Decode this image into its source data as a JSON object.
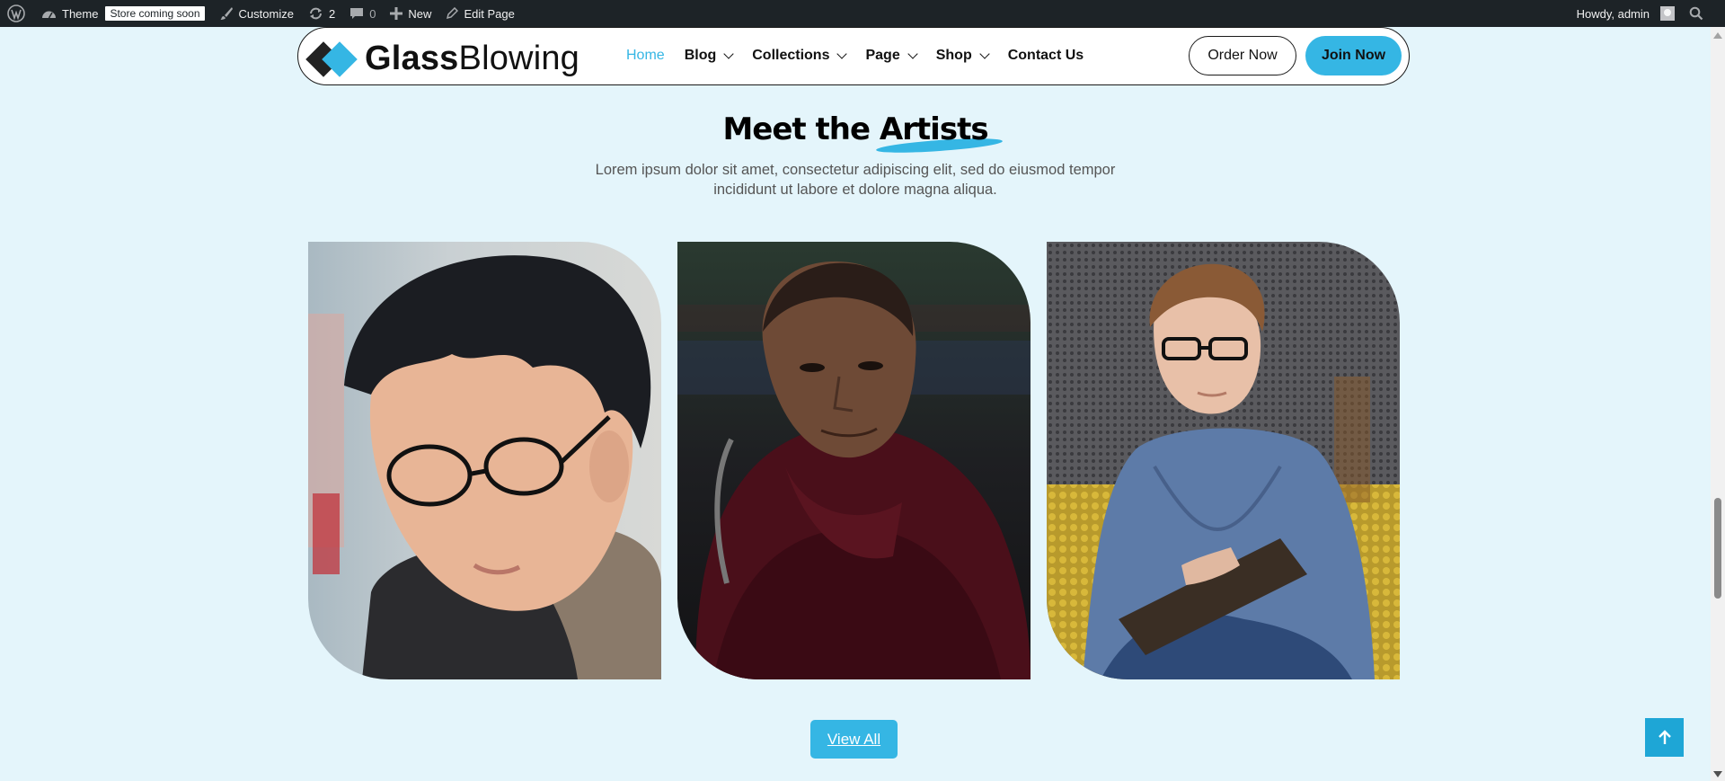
{
  "admin_bar": {
    "theme_label": "Theme",
    "store_badge": "Store coming soon",
    "customize_label": "Customize",
    "updates_count": "2",
    "comments_count": "0",
    "new_label": "New",
    "edit_label": "Edit Page",
    "greeting": "Howdy, admin"
  },
  "header": {
    "logo_bold": "Glass",
    "logo_light": "Blowing",
    "nav": [
      {
        "label": "Home",
        "active": true
      },
      {
        "label": "Blog",
        "dropdown": true
      },
      {
        "label": "Collections",
        "dropdown": true
      },
      {
        "label": "Page",
        "dropdown": true
      },
      {
        "label": "Shop",
        "dropdown": true
      },
      {
        "label": "Contact Us"
      }
    ],
    "order_button": "Order Now",
    "join_button": "Join Now"
  },
  "section": {
    "title_prefix": "Meet the ",
    "title_highlight": "Artists",
    "subtitle": "Lorem ipsum dolor sit amet, consectetur adipiscing elit, sed do eiusmod tempor incididunt ut labore et dolore magna aliqua.",
    "view_all": "View All"
  },
  "colors": {
    "accent": "#35b6e4",
    "page_bg": "#e4f5fb",
    "admin_bar": "#1d2327"
  },
  "icons": [
    "wordpress-icon",
    "theme-icon",
    "customize-icon",
    "updates-icon",
    "comment-icon",
    "plus-icon",
    "pencil-icon",
    "search-icon",
    "arrow-up-icon"
  ]
}
